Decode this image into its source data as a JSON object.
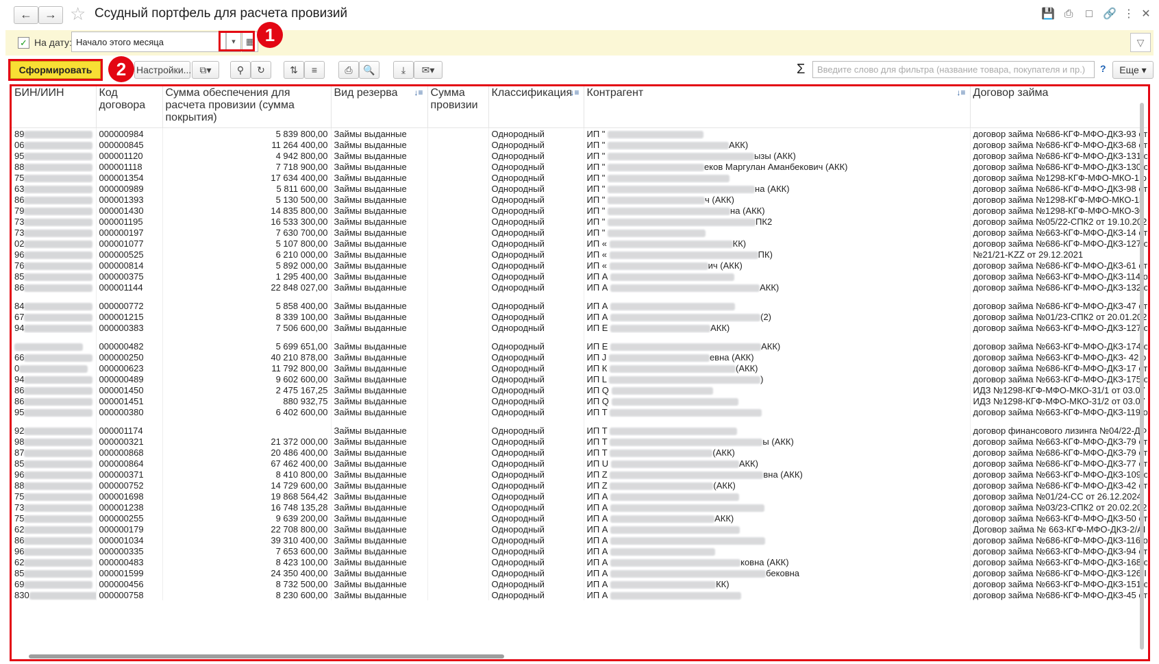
{
  "window": {
    "title": "Ссудный портфель для расчета провизий",
    "back_icon": "arrow-left-icon",
    "forward_icon": "arrow-right-icon"
  },
  "filter": {
    "checkbox_checked": true,
    "date_label": "На дату:",
    "date_value": "Начало этого месяца"
  },
  "annotations": {
    "badge1": "1",
    "badge2": "2"
  },
  "toolbar": {
    "generate_label": "Сформировать",
    "settings_label": "Настройки...",
    "search_placeholder": "Введите слово для фильтра (название товара, покупателя и пр.)",
    "help_label": "?",
    "more_label": "Еще"
  },
  "table": {
    "headers": [
      "БИН/ИИН",
      "Код договора",
      "Сумма обеспечения для расчета провизии (сумма покрытия)",
      "Вид резерва",
      "Сумма провизии",
      "Классификация",
      "Контрагент",
      "Договор займа"
    ],
    "rows": [
      {
        "bin": "89",
        "code": "000000984",
        "sum": "5 839 800,00",
        "type": "Займы выданные",
        "cls": "Однородный",
        "cp": "ИП \"",
        "cps": "",
        "loan": "договор займа №686-КГФ-МФО-ДКЗ-93 от"
      },
      {
        "bin": "06",
        "code": "000000845",
        "sum": "11 264 400,00",
        "type": "Займы выданные",
        "cls": "Однородный",
        "cp": "ИП \"",
        "cps": "АКК)",
        "loan": "договор займа №686-КГФ-МФО-ДКЗ-68 от"
      },
      {
        "bin": "95",
        "code": "000001120",
        "sum": "4 942 800,00",
        "type": "Займы выданные",
        "cls": "Однородный",
        "cp": "ИП \"",
        "cps": "ызы (АКК)",
        "loan": "договор займа №686-КГФ-МФО-ДКЗ-131 о"
      },
      {
        "bin": "88",
        "code": "000001118",
        "sum": "7 718 900,00",
        "type": "Займы выданные",
        "cls": "Однородный",
        "cp": "ИП \"",
        "cps": "еков Маргулан Аманбекович (АКК)",
        "loan": "договор займа №686-КГФ-МФО-ДКЗ-130 о"
      },
      {
        "bin": "75",
        "code": "000001354",
        "sum": "17 634 400,00",
        "type": "Займы выданные",
        "cls": "Однородный",
        "cp": "ИП \"",
        "cps": "",
        "loan": "договор займа №1298-КГФ-МФО-МКО-1 о"
      },
      {
        "bin": "63",
        "code": "000000989",
        "sum": "5 811 600,00",
        "type": "Займы выданные",
        "cls": "Однородный",
        "cp": "ИП \"",
        "cps": "на (АКК)",
        "loan": "договор займа №686-КГФ-МФО-ДКЗ-98 от"
      },
      {
        "bin": "86",
        "code": "000001393",
        "sum": "5 130 500,00",
        "type": "Займы выданные",
        "cls": "Однородный",
        "cp": "ИП \"",
        "cps": "ч (АКК)",
        "loan": "договор займа №1298-КГФ-МФО-МКО-13"
      },
      {
        "bin": "79",
        "code": "000001430",
        "sum": "14 835 800,00",
        "type": "Займы выданные",
        "cls": "Однородный",
        "cp": "ИП \"",
        "cps": "на (АКК)",
        "loan": "договор займа №1298-КГФ-МФО-МКО-30"
      },
      {
        "bin": "73",
        "code": "000001195",
        "sum": "16 533 300,00",
        "type": "Займы выданные",
        "cls": "Однородный",
        "cp": "ИП \"",
        "cps": "ПК2",
        "loan": "договор займа №05/22-СПК2 от 19.10.202"
      },
      {
        "bin": "73",
        "code": "000000197",
        "sum": "7 630 700,00",
        "type": "Займы выданные",
        "cls": "Однородный",
        "cp": "ИП \"",
        "cps": "",
        "loan": "договор займа №663-КГФ-МФО-ДКЗ-14 от"
      },
      {
        "bin": "02",
        "code": "000001077",
        "sum": "5 107 800,00",
        "type": "Займы выданные",
        "cls": "Однородный",
        "cp": "ИП «",
        "cps": "КК)",
        "loan": "договор займа №686-КГФ-МФО-ДКЗ-127 о"
      },
      {
        "bin": "96",
        "code": "000000525",
        "sum": "6 210 000,00",
        "type": "Займы выданные",
        "cls": "Однородный",
        "cp": "ИП «",
        "cps": "ПК)",
        "loan": "№21/21-KZZ от 29.12.2021"
      },
      {
        "bin": "76",
        "code": "000000814",
        "sum": "5 892 000,00",
        "type": "Займы выданные",
        "cls": "Однородный",
        "cp": "ИП «",
        "cps": "ич (АКК)",
        "loan": "договор займа №686-КГФ-МФО-ДКЗ-61 от"
      },
      {
        "bin": "85",
        "code": "000000375",
        "sum": "1 295 400,00",
        "type": "Займы выданные",
        "cls": "Однородный",
        "cp": "ИП А",
        "cps": "",
        "loan": "договор займа №663-КГФ-МФО-ДКЗ-114 о"
      },
      {
        "bin": "86",
        "code": "000001144",
        "sum": "22 848 027,00",
        "type": "Займы выданные",
        "cls": "Однородный",
        "cp": "ИП А",
        "cps": "АКК)",
        "loan": "договор займа №686-КГФ-МФО-ДКЗ-132 о"
      },
      {
        "gap": true
      },
      {
        "bin": "84",
        "code": "000000772",
        "sum": "5 858 400,00",
        "type": "Займы выданные",
        "cls": "Однородный",
        "cp": "ИП А",
        "cps": "",
        "loan": "договор займа №686-КГФ-МФО-ДКЗ-47 от"
      },
      {
        "bin": "67",
        "code": "000001215",
        "sum": "8 339 100,00",
        "type": "Займы выданные",
        "cls": "Однородный",
        "cp": "ИП А",
        "cps": "(2)",
        "loan": "договор займа №01/23-СПК2 от 20.01.202"
      },
      {
        "bin": "94",
        "code": "000000383",
        "sum": "7 506 600,00",
        "type": "Займы выданные",
        "cls": "Однородный",
        "cp": "ИП Е",
        "cps": "АКК)",
        "loan": "договор займа №663-КГФ-МФО-ДКЗ-127 о"
      },
      {
        "gap": true
      },
      {
        "bin": "",
        "code": "000000482",
        "sum": "5 699 651,00",
        "type": "Займы выданные",
        "cls": "Однородный",
        "cp": "ИП Е",
        "cps": "АКК)",
        "loan": "договор займа №663-КГФ-МФО-ДКЗ-174 о"
      },
      {
        "bin": "66",
        "code": "000000250",
        "sum": "40 210 878,00",
        "type": "Займы выданные",
        "cls": "Однородный",
        "cp": "ИП J",
        "cps": "евна (АКК)",
        "loan": "договор займа №663-КГФ-МФО-ДКЗ- 42 о"
      },
      {
        "bin": "0",
        "code": "000000623",
        "sum": "11 792 800,00",
        "type": "Займы выданные",
        "cls": "Однородный",
        "cp": "ИП К",
        "cps": "(АКК)",
        "loan": "договор займа №686-КГФ-МФО-ДКЗ-17 от"
      },
      {
        "bin": "94",
        "code": "000000489",
        "sum": "9 602 600,00",
        "type": "Займы выданные",
        "cls": "Однородный",
        "cp": "ИП L",
        "cps": ")",
        "loan": "договор займа №663-КГФ-МФО-ДКЗ-175 о"
      },
      {
        "bin": "86",
        "code": "000001450",
        "sum": "2 475 167,25",
        "type": "Займы выданные",
        "cls": "Однородный",
        "cp": "ИП Q",
        "cps": "",
        "loan": "ИДЗ №1298-КГФ-МФО-МКО-31/1 от 03.07"
      },
      {
        "bin": "86",
        "code": "000001451",
        "sum": "880 932,75",
        "type": "Займы выданные",
        "cls": "Однородный",
        "cp": "ИП Q",
        "cps": "",
        "loan": "ИДЗ №1298-КГФ-МФО-МКО-31/2 от 03.07"
      },
      {
        "bin": "95",
        "code": "000000380",
        "sum": "6 402 600,00",
        "type": "Займы выданные",
        "cls": "Однородный",
        "cp": "ИП Т",
        "cps": "",
        "loan": "договор займа №663-КГФ-МФО-ДКЗ-119 о"
      },
      {
        "gap": true
      },
      {
        "bin": "92",
        "code": "000001174",
        "sum": "",
        "type": "Займы выданные",
        "cls": "Однородный",
        "cp": "ИП Т",
        "cps": "",
        "loan": "договор финансового лизинга №04/22-ДФ"
      },
      {
        "bin": "98",
        "code": "000000321",
        "sum": "21 372 000,00",
        "type": "Займы выданные",
        "cls": "Однородный",
        "cp": "ИП Т",
        "cps": "ы (АКК)",
        "loan": "договор займа №663-КГФ-МФО-ДКЗ-79 от"
      },
      {
        "bin": "87",
        "code": "000000868",
        "sum": "20 486 400,00",
        "type": "Займы выданные",
        "cls": "Однородный",
        "cp": "ИП Т",
        "cps": "(АКК)",
        "loan": "договор займа №686-КГФ-МФО-ДКЗ-79 от"
      },
      {
        "bin": "85",
        "code": "000000864",
        "sum": "67 462 400,00",
        "type": "Займы выданные",
        "cls": "Однородный",
        "cp": "ИП U",
        "cps": "АКК)",
        "loan": "договор займа №686-КГФ-МФО-ДКЗ-77 от"
      },
      {
        "bin": "96",
        "code": "000000371",
        "sum": "8 410 800,00",
        "type": "Займы выданные",
        "cls": "Однородный",
        "cp": "ИП Z",
        "cps": "вна (АКК)",
        "loan": "договор займа №663-КГФ-МФО-ДКЗ-109 о"
      },
      {
        "bin": "88",
        "code": "000000752",
        "sum": "14 729 600,00",
        "type": "Займы выданные",
        "cls": "Однородный",
        "cp": "ИП Z",
        "cps": "(АКК)",
        "loan": "договор займа №686-КГФ-МФО-ДКЗ-42 от"
      },
      {
        "bin": "75",
        "code": "000001698",
        "sum": "19 868 564,42",
        "type": "Займы выданные",
        "cls": "Однородный",
        "cp": "ИП А",
        "cps": "",
        "loan": "договор займа №01/24-СС от 26.12.2024"
      },
      {
        "bin": "73",
        "code": "000001238",
        "sum": "16 748 135,28",
        "type": "Займы выданные",
        "cls": "Однородный",
        "cp": "ИП А",
        "cps": "",
        "loan": "договор займа №03/23-СПК2 от 20.02.202"
      },
      {
        "bin": "75",
        "code": "000000255",
        "sum": "9 639 200,00",
        "type": "Займы выданные",
        "cls": "Однородный",
        "cp": "ИП А",
        "cps": "АКК)",
        "loan": "договор займа №663-КГФ-МФО-ДКЗ-50 от"
      },
      {
        "bin": "62",
        "code": "000000179",
        "sum": "22 708 800,00",
        "type": "Займы выданные",
        "cls": "Однородный",
        "cp": "ИП А",
        "cps": "",
        "loan": "Договор займа № 663-КГФ-МФО-ДКЗ-2/АІ"
      },
      {
        "bin": "86",
        "code": "000001034",
        "sum": "39 310 400,00",
        "type": "Займы выданные",
        "cls": "Однородный",
        "cp": "ИП А",
        "cps": "",
        "loan": "договор займа №686-КГФ-МФО-ДКЗ-116 о"
      },
      {
        "bin": "96",
        "code": "000000335",
        "sum": "7 653 600,00",
        "type": "Займы выданные",
        "cls": "Однородный",
        "cp": "ИП А",
        "cps": "",
        "loan": "договор займа №663-КГФ-МФО-ДКЗ-94 от"
      },
      {
        "bin": "62",
        "code": "000000483",
        "sum": "8 423 100,00",
        "type": "Займы выданные",
        "cls": "Однородный",
        "cp": "ИП А",
        "cps": "ковна (АКК)",
        "loan": "договор займа №663-КГФ-МФО-ДКЗ-168 о"
      },
      {
        "bin": "85",
        "code": "000001599",
        "sum": "24 350 400,00",
        "type": "Займы выданные",
        "cls": "Однородный",
        "cp": "ИП А",
        "cps": "бековна",
        "loan": "договор займа №686-КГФ-МФО-ДКЗ-126-І"
      },
      {
        "bin": "69",
        "code": "000000456",
        "sum": "8 732 500,00",
        "type": "Займы выданные",
        "cls": "Однородный",
        "cp": "ИП А",
        "cps": "КК)",
        "loan": "договор займа №663-КГФ-МФО-ДКЗ-151 о"
      },
      {
        "bin": "830",
        "code": "000000758",
        "sum": "8 230 600,00",
        "type": "Займы выданные",
        "cls": "Однородный",
        "cp": "ИП А",
        "cps": "",
        "loan": "договор займа №686-КГФ-МФО-ДКЗ-45 от"
      }
    ]
  }
}
